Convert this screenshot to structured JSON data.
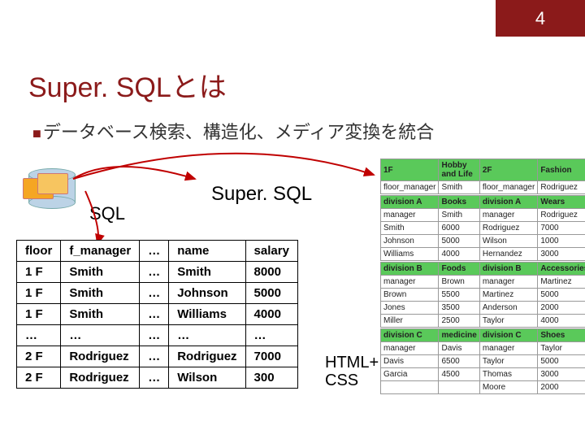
{
  "page_number": "4",
  "title": "Super. SQLとは",
  "bullet": "データベース検索、構造化、メディア変換を統合",
  "labels": {
    "sql": "SQL",
    "supersql": "Super. SQL",
    "htmlcss_line1": "HTML+",
    "htmlcss_line2": "CSS"
  },
  "flat_table": {
    "headers": [
      "floor",
      "f_manager",
      "…",
      "name",
      "salary"
    ],
    "rows": [
      [
        "1 F",
        "Smith",
        "…",
        "Smith",
        "8000"
      ],
      [
        "1 F",
        "Smith",
        "…",
        "Johnson",
        "5000"
      ],
      [
        "1 F",
        "Smith",
        "…",
        "Williams",
        "4000"
      ],
      [
        "…",
        "…",
        "…",
        "…",
        "…"
      ],
      [
        "2 F",
        "Rodriguez",
        "…",
        "Rodriguez",
        "7000"
      ],
      [
        "2 F",
        "Rodriguez",
        "…",
        "Wilson",
        "300"
      ]
    ]
  },
  "structured": {
    "floors": [
      {
        "floor_label": "1F",
        "floor_desc": "Hobby and Life",
        "floor_manager_label": "floor_manager",
        "floor_manager": "Smith",
        "divisions": [
          {
            "div_label": "division A",
            "div_name": "Books",
            "mgr_label": "manager",
            "mgr": "Smith",
            "rows": [
              [
                "Smith",
                "6000"
              ],
              [
                "Johnson",
                "5000"
              ],
              [
                "Williams",
                "4000"
              ]
            ]
          },
          {
            "div_label": "division B",
            "div_name": "Foods",
            "mgr_label": "manager",
            "mgr": "Brown",
            "rows": [
              [
                "Brown",
                "5500"
              ],
              [
                "Jones",
                "3500"
              ],
              [
                "Miller",
                "2500"
              ]
            ]
          },
          {
            "div_label": "division C",
            "div_name": "medicine",
            "mgr_label": "manager",
            "mgr": "Davis",
            "rows": [
              [
                "Davis",
                "6500"
              ],
              [
                "Garcia",
                "4500"
              ]
            ]
          }
        ]
      },
      {
        "floor_label": "2F",
        "floor_desc": "Fashion",
        "floor_manager_label": "floor_manager",
        "floor_manager": "Rodriguez",
        "divisions": [
          {
            "div_label": "division A",
            "div_name": "Wears",
            "mgr_label": "manager",
            "mgr": "Rodriguez",
            "rows": [
              [
                "Rodriguez",
                "7000"
              ],
              [
                "Wilson",
                "1000"
              ],
              [
                "Hernandez",
                "3000"
              ]
            ]
          },
          {
            "div_label": "division B",
            "div_name": "Accessories",
            "mgr_label": "manager",
            "mgr": "Martinez",
            "rows": [
              [
                "Martinez",
                "5000"
              ],
              [
                "Anderson",
                "2000"
              ],
              [
                "Taylor",
                "4000"
              ]
            ]
          },
          {
            "div_label": "division C",
            "div_name": "Shoes",
            "mgr_label": "manager",
            "mgr": "Taylor",
            "rows": [
              [
                "Taylor",
                "5000"
              ],
              [
                "Thomas",
                "3000"
              ],
              [
                "Moore",
                "2000"
              ]
            ]
          }
        ]
      }
    ]
  }
}
